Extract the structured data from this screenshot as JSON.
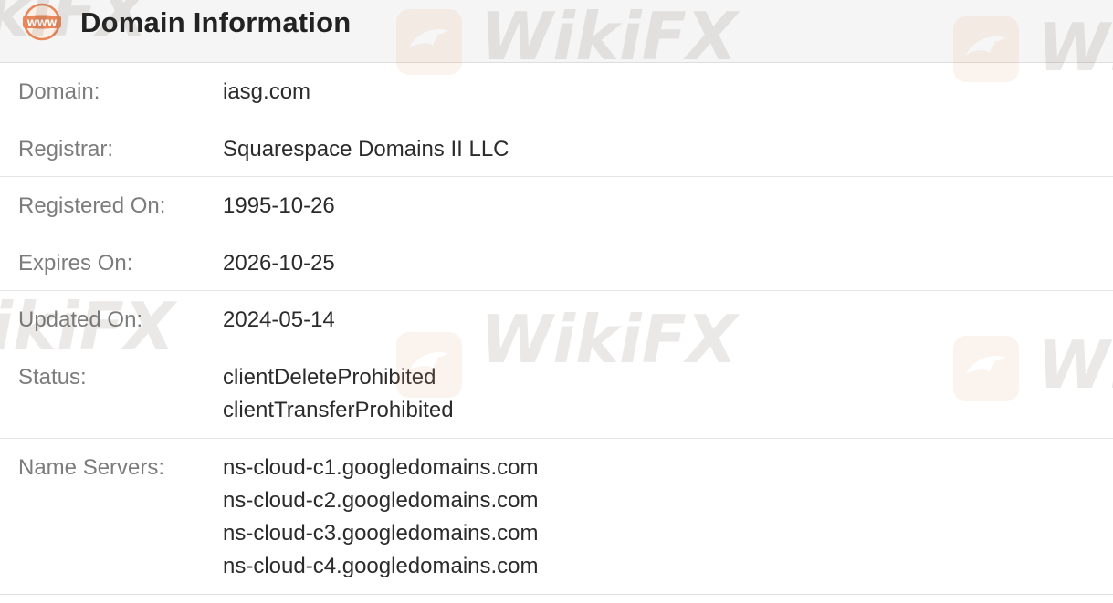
{
  "header": {
    "icon": "www-globe-icon",
    "title": "Domain Information"
  },
  "rows": [
    {
      "label": "Domain:",
      "values": [
        "iasg.com"
      ]
    },
    {
      "label": "Registrar:",
      "values": [
        "Squarespace Domains II LLC"
      ]
    },
    {
      "label": "Registered On:",
      "values": [
        "1995-10-26"
      ]
    },
    {
      "label": "Expires On:",
      "values": [
        "2026-10-25"
      ]
    },
    {
      "label": "Updated On:",
      "values": [
        "2024-05-14"
      ]
    },
    {
      "label": "Status:",
      "values": [
        "clientDeleteProhibited",
        "clientTransferProhibited"
      ]
    },
    {
      "label": "Name Servers:",
      "values": [
        "ns-cloud-c1.googledomains.com",
        "ns-cloud-c2.googledomains.com",
        "ns-cloud-c3.googledomains.com",
        "ns-cloud-c4.googledomains.com"
      ]
    }
  ],
  "watermark": {
    "text": "WikiFX",
    "color": "#e8a57a"
  },
  "colors": {
    "icon_accent": "#e8875a",
    "label": "#7c7c7c",
    "value": "#2b2b2b",
    "header_bg": "#f5f5f5"
  }
}
